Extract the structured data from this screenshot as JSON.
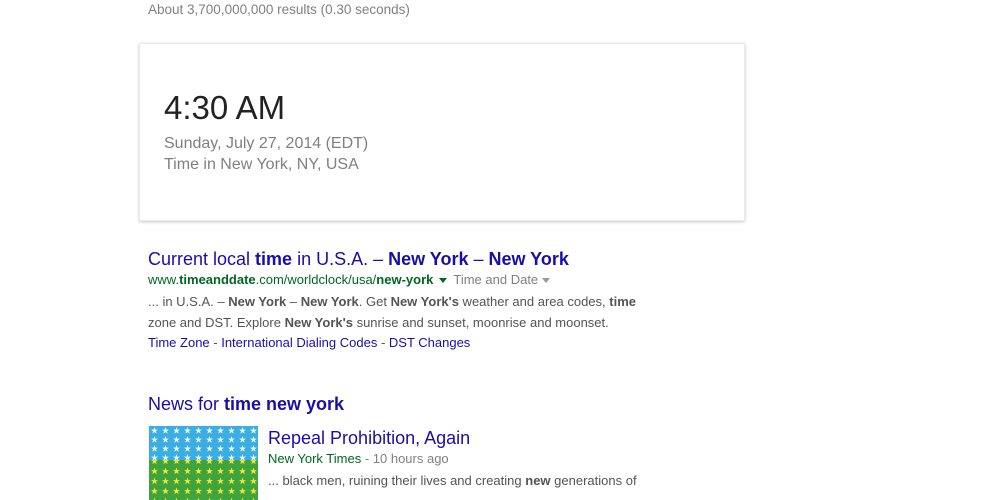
{
  "result_stats": "About 3,700,000,000 results (0.30 seconds)",
  "time_card": {
    "time": "4:30 AM",
    "date": "Sunday, July 27, 2014 (EDT)",
    "location": "Time in New York, NY, USA"
  },
  "result": {
    "title_parts": [
      "Current local ",
      "time",
      " in U.S.A. – ",
      "New York",
      " – ",
      "New York"
    ],
    "url_parts": [
      "www.",
      "timeanddate",
      ".com/worldclock/usa/",
      "new-york"
    ],
    "category": "Time and Date",
    "snippet_line1": [
      "... in U.S.A. – ",
      "New York",
      " – ",
      "New York",
      ". Get ",
      "New York's",
      " weather and area codes, ",
      "time"
    ],
    "snippet_line2": [
      "zone and DST. Explore ",
      "New York's",
      " sunrise and sunset, moonrise and moonset."
    ],
    "sitelinks": [
      "Time Zone",
      "International Dialing Codes",
      "DST Changes"
    ],
    "sitelink_separator": " - "
  },
  "news": {
    "header_parts": [
      "News for ",
      "time new york"
    ],
    "item": {
      "title": "Repeal Prohibition, Again",
      "source": "New York Times",
      "ago": "10 hours ago",
      "snippet_parts": [
        "... black men, ruining their lives and creating ",
        "new",
        " generations of"
      ]
    }
  },
  "colors": {
    "link": "#1a0dab",
    "url_green": "#006621",
    "snippet": "#545454",
    "meta_grey": "#808080"
  }
}
